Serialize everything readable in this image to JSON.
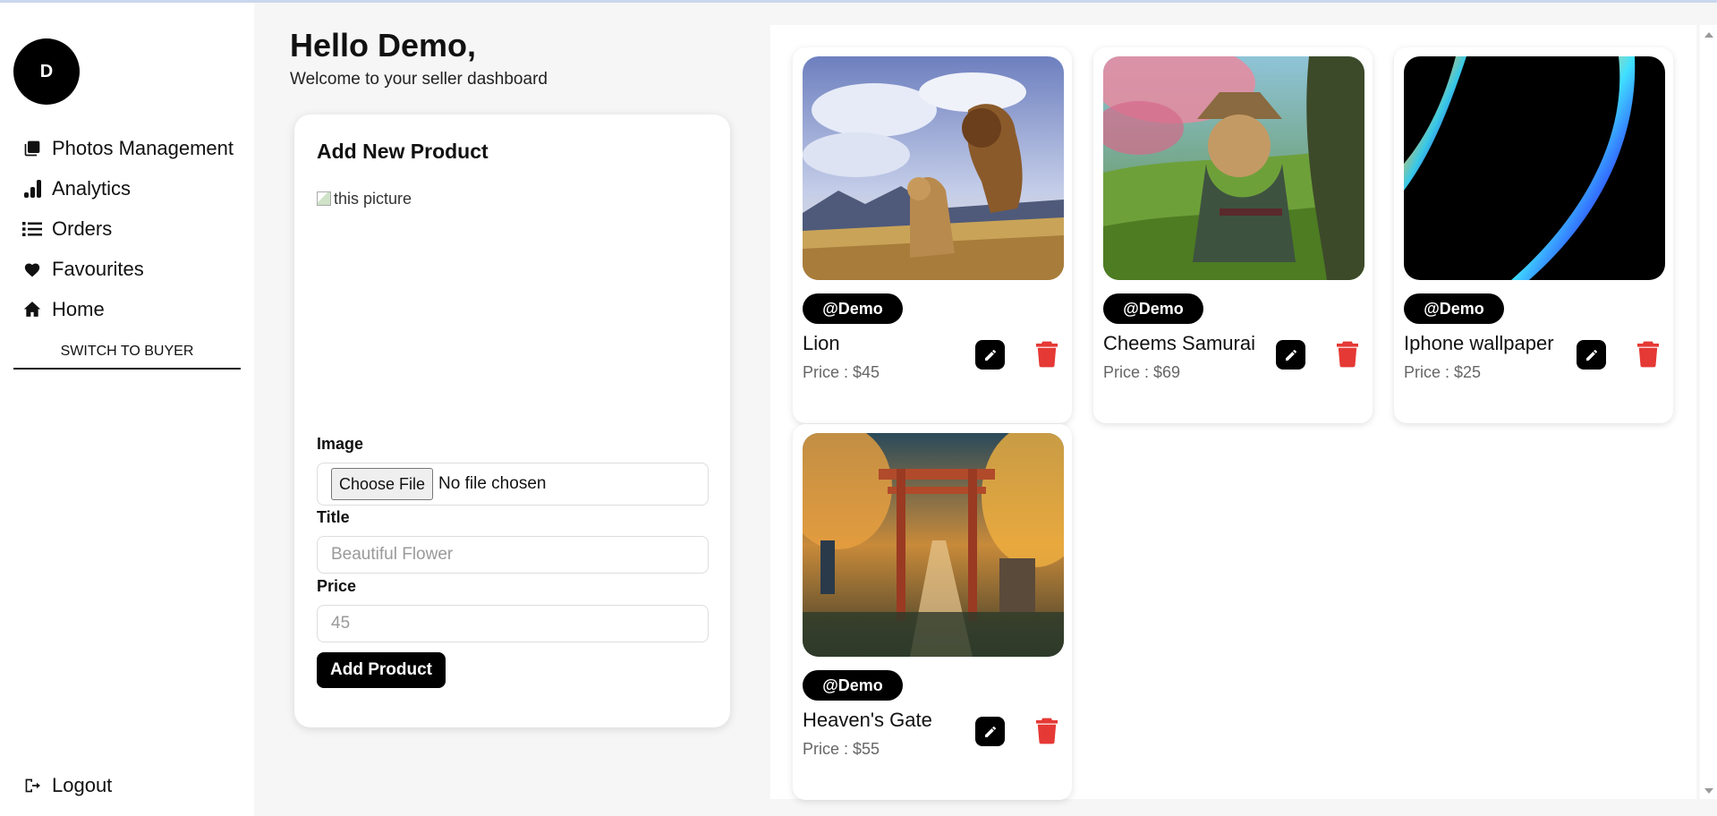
{
  "sidebar": {
    "avatar_initial": "D",
    "items": [
      {
        "label": "Photos Management",
        "icon": "photos-icon"
      },
      {
        "label": "Analytics",
        "icon": "analytics-icon"
      },
      {
        "label": "Orders",
        "icon": "list-icon"
      },
      {
        "label": "Favourites",
        "icon": "heart-icon"
      },
      {
        "label": "Home",
        "icon": "home-icon"
      }
    ],
    "switch_label": "SWITCH TO BUYER",
    "logout_label": "Logout"
  },
  "header": {
    "greeting": "Hello Demo,",
    "subtitle": "Welcome to your seller dashboard"
  },
  "form": {
    "title": "Add New Product",
    "preview_alt": "this picture",
    "image_label": "Image",
    "file_button": "Choose File",
    "file_status": "No file chosen",
    "title_label": "Title",
    "title_placeholder": "Beautiful Flower",
    "price_label": "Price",
    "price_placeholder": "45",
    "submit_label": "Add Product"
  },
  "products": [
    {
      "owner": "@Demo",
      "title": "Lion",
      "price": "Price : $45"
    },
    {
      "owner": "@Demo",
      "title": "Cheems Samurai",
      "price": "Price : $69"
    },
    {
      "owner": "@Demo",
      "title": "Iphone wallpaper",
      "price": "Price : $25"
    },
    {
      "owner": "@Demo",
      "title": "Heaven's Gate",
      "price": "Price : $55"
    }
  ],
  "colors": {
    "accent": "#000000",
    "delete": "#e53935",
    "background": "#f6f6f6"
  }
}
